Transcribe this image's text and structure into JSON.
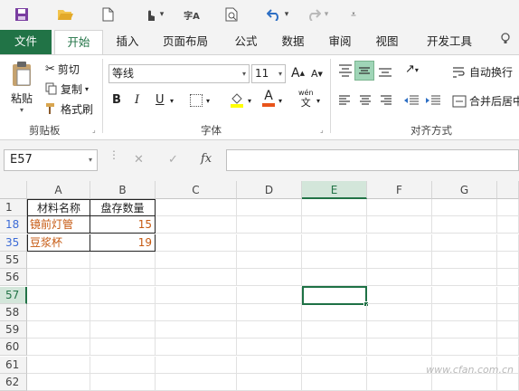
{
  "quick_access": {
    "save": "save-icon",
    "open": "open-icon",
    "new": "new-icon",
    "touch": "touch-mode-icon",
    "spell": "字A",
    "preview": "print-preview-icon",
    "undo": "undo-icon",
    "redo": "redo-icon",
    "customize": "customize-icon"
  },
  "tabs": {
    "file": "文件",
    "home": "开始",
    "insert": "插入",
    "layout": "页面布局",
    "formulas": "公式",
    "data": "数据",
    "review": "审阅",
    "view": "视图",
    "developer": "开发工具"
  },
  "clipboard": {
    "paste": "粘贴",
    "cut": "剪切",
    "copy": "复制",
    "format_painter": "格式刷",
    "label": "剪贴板"
  },
  "font": {
    "name": "等线",
    "size": "11",
    "grow": "A",
    "shrink": "A",
    "bold": "B",
    "italic": "I",
    "underline": "U",
    "font_color_glyph": "A",
    "wen": "wén",
    "wen_char": "文",
    "label": "字体"
  },
  "align": {
    "wrap": "自动换行",
    "merge": "合并后居中",
    "label": "对齐方式"
  },
  "formula_bar": {
    "name_box": "E57",
    "fx": "fx",
    "content": ""
  },
  "columns": [
    "A",
    "B",
    "C",
    "D",
    "E",
    "F",
    "G"
  ],
  "rows": [
    {
      "num": "1",
      "a": "材料名称",
      "b": "盘存数量"
    },
    {
      "num": "18",
      "a": "镜前灯管",
      "b": "15"
    },
    {
      "num": "35",
      "a": "豆浆杯",
      "b": "19"
    },
    {
      "num": "55",
      "a": "",
      "b": ""
    },
    {
      "num": "56",
      "a": "",
      "b": ""
    },
    {
      "num": "57",
      "a": "",
      "b": ""
    },
    {
      "num": "58",
      "a": "",
      "b": ""
    },
    {
      "num": "59",
      "a": "",
      "b": ""
    },
    {
      "num": "60",
      "a": "",
      "b": ""
    },
    {
      "num": "61",
      "a": "",
      "b": ""
    },
    {
      "num": "62",
      "a": "",
      "b": ""
    }
  ],
  "colors": {
    "accent": "#217346",
    "filtered_row": "#3c6bd6",
    "orange_text": "#c65911",
    "selected": "#1e7145"
  },
  "watermark": "www.cfan.com.cn"
}
